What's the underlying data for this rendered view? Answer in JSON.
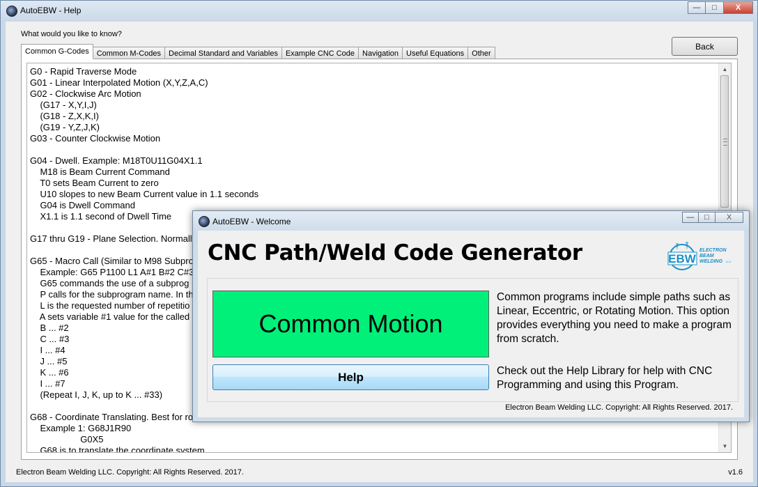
{
  "window": {
    "title": "AutoEBW - Help",
    "caption": {
      "minimize": "—",
      "maximize": "□",
      "close": "X"
    }
  },
  "help": {
    "prompt": "What would you like to know?",
    "back_label": "Back",
    "tabs": [
      "Common G-Codes",
      "Common M-Codes",
      "Decimal Standard and Variables",
      "Example CNC Code",
      "Navigation",
      "Useful Equations",
      "Other"
    ],
    "active_tab": "Common G-Codes",
    "lines": [
      "G0 - Rapid Traverse Mode",
      "G01 - Linear Interpolated Motion (X,Y,Z,A,C)",
      "G02 - Clockwise Arc Motion",
      "    (G17 - X,Y,I,J)",
      "    (G18 - Z,X,K,I)",
      "    (G19 - Y,Z,J,K)",
      "G03 - Counter Clockwise Motion",
      "",
      "G04 - Dwell. Example: M18T0U11G04X1.1",
      "    M18 is Beam Current Command",
      "    T0 sets Beam Current to zero",
      "    U10 slopes to new Beam Current value in 1.1 seconds",
      "    G04 is Dwell Command",
      "    X1.1 is 1.1 second of Dwell Time",
      "",
      "G17 thru G19 - Plane Selection. Normally",
      "",
      "G65 - Macro Call (Similar to M98 Subpro",
      "    Example: G65 P1100 L1 A#1 B#2 C#3",
      "    G65 commands the use of a subprog",
      "    P calls for the subprogram name. In th",
      "    L is the requested number of repetitio",
      "    A sets variable #1 value for the called",
      "    B ... #2",
      "    C ... #3",
      "    I ... #4",
      "    J ... #5",
      "    K ... #6",
      "    I ... #7",
      "    (Repeat I, J, K, up to K ... #33)",
      "",
      "G68 - Coordinate Translating. Best for ro",
      "    Example 1: G68J1R90",
      "                    G0X5",
      "    G68 is to translate the coordinate system"
    ],
    "status_left": "Electron Beam Welding LLC. Copyright: All Rights Reserved. 2017.",
    "version": "v1.6"
  },
  "welcome": {
    "title": "AutoEBW - Welcome",
    "heading": "CNC Path/Weld Code Generator",
    "logo_text": "EBW",
    "logo_caption": [
      "ELECTRON",
      "BEAM",
      "WELDING"
    ],
    "logo_suffix": "LLC",
    "common_motion_label": "Common Motion",
    "help_label": "Help",
    "desc_common": "Common programs include simple paths such as Linear, Eccentric, or Rotating Motion. This option provides everything you need to make a program from scratch.",
    "desc_help": "Check out the Help Library for help with CNC Programming and using this Program.",
    "footer": "Electron Beam Welding LLC. Copyright: All Rights Reserved. 2017.",
    "colors": {
      "common_motion_bg": "#00f07a",
      "help_btn": "#bee6fd",
      "logo_blue": "#1a8fc8"
    }
  }
}
